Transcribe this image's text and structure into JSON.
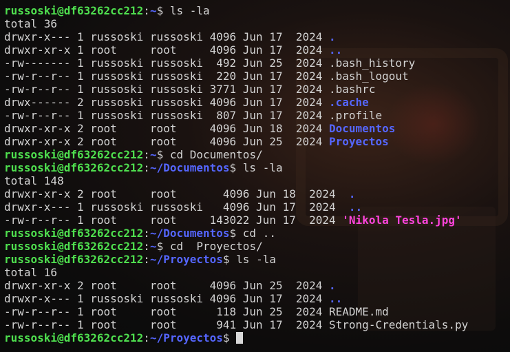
{
  "prompt_user": "russoski@df63262cc212",
  "lines": [
    {
      "kind": "prompt",
      "path": "~",
      "cmd": "ls -la"
    },
    {
      "kind": "text",
      "text": "total 36"
    },
    {
      "kind": "entry",
      "meta": "drwxr-x--- 1 russoski russoski 4096 Jun 17  2024 ",
      "name": ".",
      "style": "dir"
    },
    {
      "kind": "entry",
      "meta": "drwxr-xr-x 1 root     root     4096 Jun 17  2024 ",
      "name": "..",
      "style": "dir"
    },
    {
      "kind": "entry",
      "meta": "-rw------- 1 russoski russoski  492 Jun 25  2024 ",
      "name": ".bash_history",
      "style": "plain"
    },
    {
      "kind": "entry",
      "meta": "-rw-r--r-- 1 russoski russoski  220 Jun 17  2024 ",
      "name": ".bash_logout",
      "style": "plain"
    },
    {
      "kind": "entry",
      "meta": "-rw-r--r-- 1 russoski russoski 3771 Jun 17  2024 ",
      "name": ".bashrc",
      "style": "plain"
    },
    {
      "kind": "entry",
      "meta": "drwx------ 2 russoski russoski 4096 Jun 17  2024 ",
      "name": ".cache",
      "style": "dir"
    },
    {
      "kind": "entry",
      "meta": "-rw-r--r-- 1 russoski russoski  807 Jun 17  2024 ",
      "name": ".profile",
      "style": "plain"
    },
    {
      "kind": "entry",
      "meta": "drwxr-xr-x 2 root     root     4096 Jun 18  2024 ",
      "name": "Documentos",
      "style": "dir"
    },
    {
      "kind": "entry",
      "meta": "drwxr-xr-x 2 root     root     4096 Jun 25  2024 ",
      "name": "Proyectos",
      "style": "dir"
    },
    {
      "kind": "prompt",
      "path": "~",
      "cmd": "cd Documentos/"
    },
    {
      "kind": "prompt",
      "path": "~/Documentos",
      "cmd": "ls -la"
    },
    {
      "kind": "text",
      "text": "total 148"
    },
    {
      "kind": "entry",
      "meta": "drwxr-xr-x 2 root     root       4096 Jun 18  2024  ",
      "name": ".",
      "style": "dir"
    },
    {
      "kind": "entry",
      "meta": "drwxr-x--- 1 russoski russoski   4096 Jun 17  2024  ",
      "name": "..",
      "style": "dir"
    },
    {
      "kind": "entry",
      "meta": "-rw-r--r-- 1 root     root     143022 Jun 17  2024 ",
      "name": "'Nikola Tesla.jpg'",
      "style": "img"
    },
    {
      "kind": "prompt",
      "path": "~/Documentos",
      "cmd": "cd .."
    },
    {
      "kind": "prompt",
      "path": "~",
      "cmd": "cd  Proyectos/"
    },
    {
      "kind": "prompt",
      "path": "~/Proyectos",
      "cmd": "ls -la"
    },
    {
      "kind": "text",
      "text": "total 16"
    },
    {
      "kind": "entry",
      "meta": "drwxr-xr-x 2 root     root     4096 Jun 25  2024 ",
      "name": ".",
      "style": "dir"
    },
    {
      "kind": "entry",
      "meta": "drwxr-x--- 1 russoski russoski 4096 Jun 17  2024 ",
      "name": "..",
      "style": "dir"
    },
    {
      "kind": "entry",
      "meta": "-rw-r--r-- 1 root     root      118 Jun 25  2024 ",
      "name": "README.md",
      "style": "plain"
    },
    {
      "kind": "entry",
      "meta": "-rw-r--r-- 1 root     root      941 Jun 17  2024 ",
      "name": "Strong-Credentials.py",
      "style": "plain"
    },
    {
      "kind": "prompt",
      "path": "~/Proyectos",
      "cmd": "",
      "cursor": true
    }
  ]
}
